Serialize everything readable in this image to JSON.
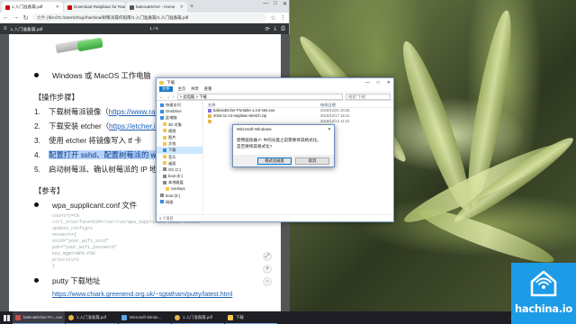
{
  "browser": {
    "tabs": [
      {
        "label": "1.入门准备篇.pdf",
        "favicon": "pdf-icon",
        "active": true
      },
      {
        "label": "Download Raspbian for Rasp",
        "favicon": "raspberry-icon",
        "active": false
      },
      {
        "label": "balenaEtcher - Home",
        "favicon": "etcher-icon",
        "active": false
      }
    ],
    "address": {
      "protocol": "文件",
      "url": "file:///C:/Users/zhujc/hachina/树莓派操作指南/1.入门准备篇/1.入门准备篇.pdf"
    },
    "pdf_toolbar": {
      "filename": "1.入门准备篇.pdf",
      "page_indicator": "1 / 5"
    },
    "document": {
      "bullet1": "Windows 或 MacOS 工作电脑",
      "steps_heading": "【操作步骤】",
      "steps": [
        {
          "num": "1.",
          "text": "下载树莓派镜像（",
          "link": "https://www.ras"
        },
        {
          "num": "2.",
          "text": "下载安装 etcher（",
          "link": "https://etcher.io"
        },
        {
          "num": "3.",
          "text": "使用 etcher 将镜像写入 tf 卡",
          "link": ""
        },
        {
          "num": "4.",
          "text": "配置打开 sshd、配置树莓派的 wifi",
          "link": ""
        },
        {
          "num": "5.",
          "text": "启动树莓派、确认树莓派的 IP 地址",
          "link": ""
        }
      ],
      "ref_heading": "【参考】",
      "ref_bullet1": "wpa_supplicant.conf 文件",
      "code_lines": [
        "country=CN",
        "ctrl_interface=DIR=/var/run/wpa_supplicant GROUP=netdev",
        "update_config=1",
        "network={",
        "ssid=\"your_wifi_ssid\"",
        "psk=\"your_wifi_password\"",
        "key_mgmt=WPA-PSK",
        "priority=1",
        "}"
      ],
      "ref_bullet2": "putty 下载地址",
      "putty_link": "https://www.chiark.greenend.org.uk/~sgtatham/putty/latest.html"
    },
    "window_controls": [
      "—",
      "□",
      "✕"
    ]
  },
  "explorer": {
    "title": "下载",
    "ribbon": [
      "文件",
      "主页",
      "共享",
      "查看"
    ],
    "breadcrumb": "> 此电脑 > 下载",
    "search_placeholder": "搜索\"下载\"",
    "nav_items": [
      {
        "label": "快速访问",
        "icon": "star-icon"
      },
      {
        "label": "OneDrive",
        "icon": "cloud-icon"
      },
      {
        "label": "此电脑",
        "icon": "computer-icon"
      },
      {
        "label": "3D 对象",
        "icon": "folder-icon"
      },
      {
        "label": "视频",
        "icon": "folder-icon"
      },
      {
        "label": "图片",
        "icon": "folder-icon"
      },
      {
        "label": "文档",
        "icon": "folder-icon"
      },
      {
        "label": "下载",
        "icon": "download-icon",
        "selected": true
      },
      {
        "label": "音乐",
        "icon": "folder-icon"
      },
      {
        "label": "桌面",
        "icon": "folder-icon"
      },
      {
        "label": "OS (C:)",
        "icon": "drive-icon"
      },
      {
        "label": "boot (E:)",
        "icon": "drive-icon"
      },
      {
        "label": "本地磁盘",
        "icon": "drive-icon"
      },
      {
        "label": "overlays",
        "icon": "folder-icon"
      },
      {
        "label": "boot (E:)",
        "icon": "drive-icon"
      },
      {
        "label": "网络",
        "icon": "network-icon"
      }
    ],
    "columns": [
      "名称",
      "修改日期"
    ],
    "files": [
      {
        "name": "balenaEtcher-Portable-1.4.8-x64.exe",
        "date": "2018/12/21 20:25",
        "type": "exe"
      },
      {
        "name": "2018-11-13-raspbian-stretch.zip",
        "date": "2018/12/17 15:41",
        "type": "zip"
      },
      {
        "name": "",
        "date": "2018/12/13 11:21",
        "type": "file"
      }
    ],
    "status": "5 个项目"
  },
  "dialog": {
    "title": "Microsoft Windows",
    "message": "使用驱动器 F: 中的光盘之前需要将其格式化。",
    "question": "是否要将其格式化?",
    "primary_button": "格式化磁盘",
    "cancel_button": "取消"
  },
  "taskbar": {
    "items": [
      {
        "label": "balenaEtcher-Po...exe",
        "icon": "etcher-icon",
        "active": true
      },
      {
        "label": "1.入门准备篇.pdf",
        "icon": "chrome-icon",
        "active": false
      },
      {
        "label": "Microsoft Windo...",
        "icon": "window-icon",
        "active": false
      },
      {
        "label": "1.入门准备篇.pdf",
        "icon": "chrome-icon",
        "active": false
      },
      {
        "label": "下载",
        "icon": "folder-icon",
        "active": false
      }
    ]
  },
  "logo": {
    "brand": "hachina.io"
  },
  "colors": {
    "accent": "#1c9be6",
    "link": "#1a5fb4",
    "highlight": "#b4d2f7",
    "taskbar": "#1e1e24"
  }
}
